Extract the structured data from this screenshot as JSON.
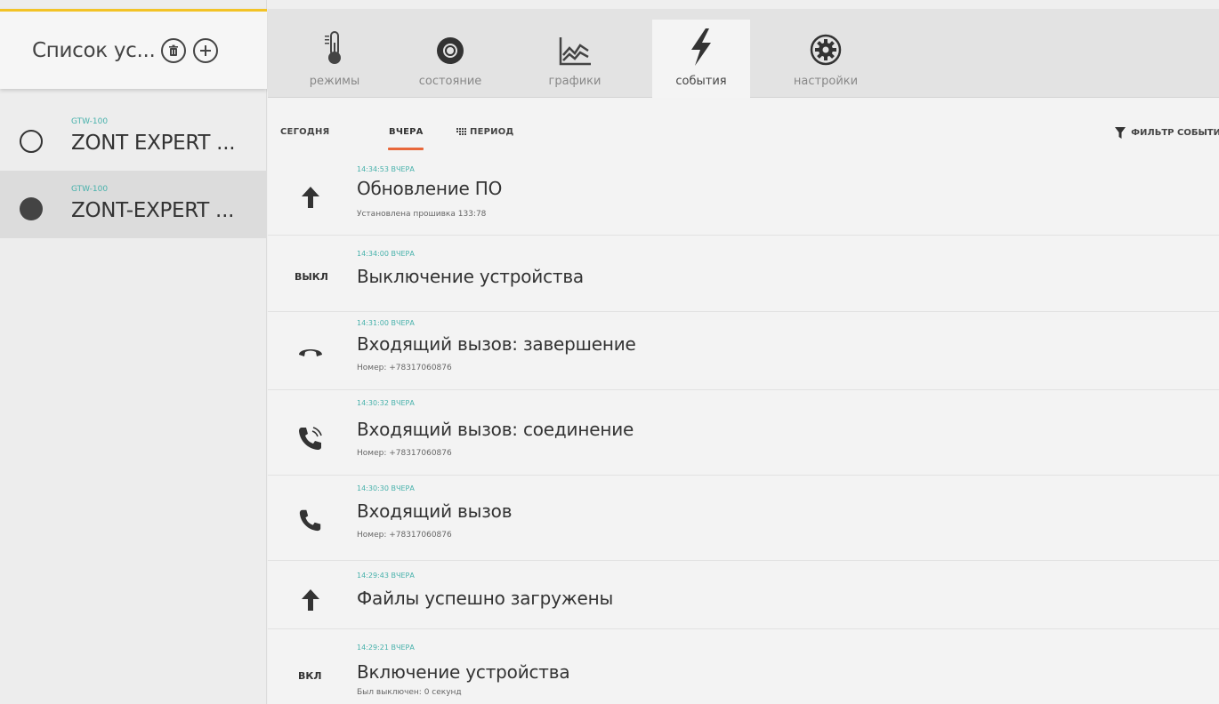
{
  "sidebar": {
    "title": "Список ус...",
    "delete_icon": "trash-icon",
    "add_icon": "plus-icon",
    "devices": [
      {
        "model": "GTW-100",
        "name": "ZONT EXPERT ...",
        "status": "offline"
      },
      {
        "model": "GTW-100",
        "name": "ZONT-EXPERT ...",
        "status": "online"
      }
    ]
  },
  "tabs": [
    {
      "label": "режимы",
      "icon": "thermometer-icon"
    },
    {
      "label": "состояние",
      "icon": "status-ring-icon"
    },
    {
      "label": "графики",
      "icon": "chart-icon"
    },
    {
      "label": "события",
      "icon": "lightning-icon",
      "active": true
    },
    {
      "label": "настройки",
      "icon": "gear-icon"
    }
  ],
  "filters": {
    "today": "СЕГОДНЯ",
    "yesterday": "ВЧЕРА",
    "period": "ПЕРИОД",
    "active": "yesterday",
    "event_filter": "ФИЛЬТР СОБЫТИ"
  },
  "events": [
    {
      "time": "14:34:53 ВЧЕРА",
      "title": "Обновление ПО",
      "desc": "Установлена прошивка 133:78",
      "icon": "arrow-up-icon"
    },
    {
      "time": "14:34:00 ВЧЕРА",
      "title": "Выключение устройства",
      "desc": "",
      "icon": "text-icon",
      "icon_text": "ВЫКЛ"
    },
    {
      "time": "14:31:00 ВЧЕРА",
      "title": "Входящий вызов: завершение",
      "desc": "Номер: +78317060876",
      "icon": "hangup-icon"
    },
    {
      "time": "14:30:32 ВЧЕРА",
      "title": "Входящий вызов: соединение",
      "desc": "Номер: +78317060876",
      "icon": "phone-ringing-icon"
    },
    {
      "time": "14:30:30 ВЧЕРА",
      "title": "Входящий вызов",
      "desc": "Номер: +78317060876",
      "icon": "phone-icon"
    },
    {
      "time": "14:29:43 ВЧЕРА",
      "title": "Файлы успешно загружены",
      "desc": "",
      "icon": "arrow-up-icon"
    },
    {
      "time": "14:29:21 ВЧЕРА",
      "title": "Включение устройства",
      "desc": "Был выключен: 0 секунд",
      "icon": "text-icon",
      "icon_text": "ВКЛ"
    }
  ],
  "colors": {
    "accent_teal": "#47b1ab",
    "underline_orange": "#e8673a",
    "header_top": "#f3c326"
  }
}
